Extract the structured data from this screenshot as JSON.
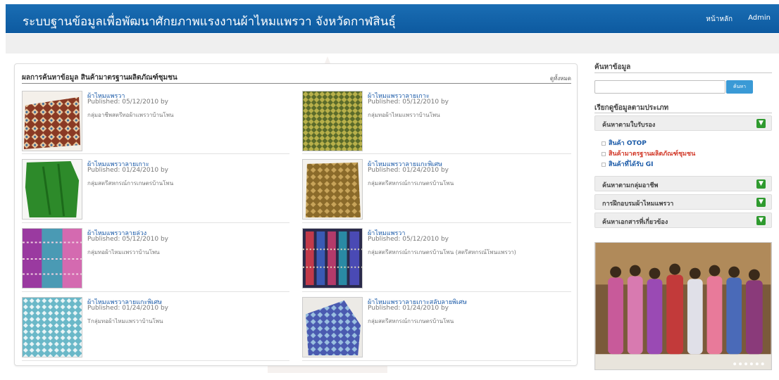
{
  "header": {
    "title": "ระบบฐานข้อมูลเพื่อพัฒนาศักยภาพแรงงานผ้าไหมแพรวา  จังหวัดกาฬสินธุ์",
    "nav": [
      "หน้าหลัก",
      "Admin"
    ]
  },
  "results": {
    "title": "ผลการค้นหาข้อมูล สินค้ามาตรฐานผลิตภัณฑ์ชุมชน",
    "view_all": "ดูทั้งหมด",
    "items": [
      {
        "title": "ผ้าไหมแพรวา",
        "published": "Published: 05/12/2010 by",
        "group": "กลุ่มอาชีพสตรีทอผ้าแพรวาบ้านโพน"
      },
      {
        "title": "ผ้าไหมแพรวาลายเกาะ",
        "published": "Published: 05/12/2010 by",
        "group": "กลุ่มทอผ้าไหมแพรวาบ้านโพน"
      },
      {
        "title": "ผ้าไหมแพรวาลายเกาะ",
        "published": "Published: 01/24/2010 by",
        "group": "กลุ่มสตรีสหกรณ์การเกษตรบ้านโพน"
      },
      {
        "title": "ผ้าไหมแพรวาลายแกะพิเศษ",
        "published": "Published: 01/24/2010 by",
        "group": "กลุ่มสตรีสหกรณ์การเกษตรบ้านโพน"
      },
      {
        "title": "ผ้าไหมแพรวาลายล่วง",
        "published": "Published: 05/12/2010 by",
        "group": "กลุ่มทอผ้าไหมแพรวาบ้านโพน"
      },
      {
        "title": "ผ้าไหมแพรวา",
        "published": "Published: 05/12/2010 by",
        "group": "กลุ่มสตรีสหกรณ์การเกษตรบ้านโพน (สตรีสหกรณ์โพนแพรวา)"
      },
      {
        "title": "ผ้าไหมแพรวาลายแกะพิเศษ",
        "published": "Published: 01/24/2010 by",
        "group": "Tกลุ่มทอผ้าไหมแพรวาบ้านโพน"
      },
      {
        "title": "ผ้าไหมแพรวาลายเกาะสลับลายพิเศษ",
        "published": "Published: 01/24/2010 by",
        "group": "กลุ่มสตรีสหกรณ์การเกษตรบ้านโพน"
      }
    ]
  },
  "sidebar": {
    "search_heading": "ค้นหาข้อมูล",
    "search_value": "",
    "search_button": "ค้นหา",
    "browse_heading": "เรียกดูข้อมูลตามประเภท",
    "accordion": [
      {
        "label": "ค้นหาตามใบรับรอง",
        "icon": "expand-icon"
      },
      {
        "label": "ค้นหาตามกลุ่มอาชีพ",
        "icon": "expand-icon"
      },
      {
        "label": "การฝึกอบรมผ้าไหมแพรวา",
        "icon": "expand-icon"
      },
      {
        "label": "ค้นหาเอกสารที่เกี่ยวข้อง",
        "icon": "expand-icon"
      }
    ],
    "cert_links": [
      {
        "label": "สินค้า OTOP",
        "color": "#1a5aa8"
      },
      {
        "label": "สินค้ามาตรฐานผลิตภัณฑ์ชุมชน",
        "color": "#d23a2a"
      },
      {
        "label": "สินค้าที่ได้รับ GI",
        "color": "#1a5aa8"
      }
    ]
  },
  "colors": {
    "header": "#0d5aa0",
    "accent": "#3a9ad6",
    "expand": "#2f9a2f"
  }
}
